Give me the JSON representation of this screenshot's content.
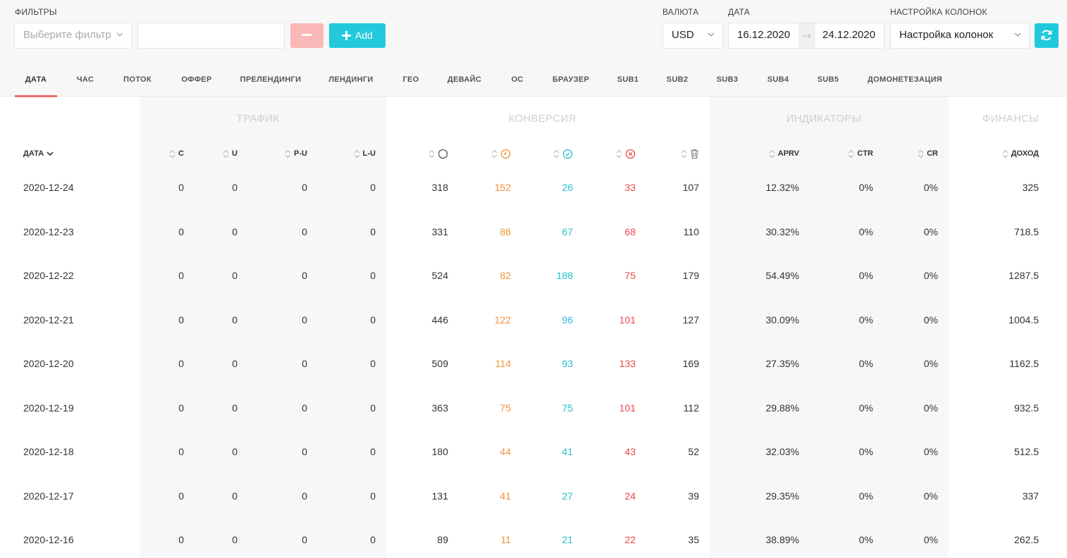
{
  "header": {
    "filters_label": "ФИЛЬТРЫ",
    "filter_placeholder": "Выберите фильтр",
    "add_label": "Add",
    "currency_label": "ВАЛЮТА",
    "currency_value": "USD",
    "date_label": "ДАТА",
    "date_from": "16.12.2020",
    "date_to": "24.12.2020",
    "columns_label": "НАСТРОЙКА КОЛОНОК",
    "columns_value": "Настройка колонок"
  },
  "tabs": [
    "ДАТА",
    "ЧАС",
    "ПОТОК",
    "ОФФЕР",
    "ПРЕЛЕНДИНГИ",
    "ЛЕНДИНГИ",
    "ГЕО",
    "ДЕВАЙС",
    "ОС",
    "БРАУЗЕР",
    "SUB1",
    "SUB2",
    "SUB3",
    "SUB4",
    "SUB5",
    "ДОМОНЕТЕЗАЦИЯ"
  ],
  "active_tab": "ДАТА",
  "groups": {
    "traffic": "ТРАФИК",
    "conversion": "КОНВЕРСИЯ",
    "indicators": "ИНДИКАТОРЫ",
    "finance": "ФИНАНСЫ"
  },
  "columns": {
    "date": "ДАТА",
    "c": "C",
    "u": "U",
    "pu": "P-U",
    "lu": "L-U",
    "aprv": "APRV",
    "ctr": "CTR",
    "cr": "CR",
    "income": "ДОХОД"
  },
  "conversion_icons": [
    "circle-icon",
    "clock-icon",
    "check-circle-icon",
    "x-circle-icon",
    "trash-icon"
  ],
  "colors": {
    "accent": "#22c9dc",
    "pending": "#f2913a",
    "approved": "#22c0d4",
    "rejected": "#ef4747",
    "remove_button": "#fbb8b8"
  },
  "rows": [
    {
      "date": "2020-12-24",
      "c": "0",
      "u": "0",
      "pu": "0",
      "lu": "0",
      "total": "318",
      "pending": "152",
      "approved": "26",
      "rejected": "33",
      "trash": "107",
      "aprv": "12.32%",
      "ctr": "0%",
      "cr": "0%",
      "income": "325"
    },
    {
      "date": "2020-12-23",
      "c": "0",
      "u": "0",
      "pu": "0",
      "lu": "0",
      "total": "331",
      "pending": "86",
      "approved": "67",
      "rejected": "68",
      "trash": "110",
      "aprv": "30.32%",
      "ctr": "0%",
      "cr": "0%",
      "income": "718.5"
    },
    {
      "date": "2020-12-22",
      "c": "0",
      "u": "0",
      "pu": "0",
      "lu": "0",
      "total": "524",
      "pending": "82",
      "approved": "188",
      "rejected": "75",
      "trash": "179",
      "aprv": "54.49%",
      "ctr": "0%",
      "cr": "0%",
      "income": "1287.5"
    },
    {
      "date": "2020-12-21",
      "c": "0",
      "u": "0",
      "pu": "0",
      "lu": "0",
      "total": "446",
      "pending": "122",
      "approved": "96",
      "rejected": "101",
      "trash": "127",
      "aprv": "30.09%",
      "ctr": "0%",
      "cr": "0%",
      "income": "1004.5"
    },
    {
      "date": "2020-12-20",
      "c": "0",
      "u": "0",
      "pu": "0",
      "lu": "0",
      "total": "509",
      "pending": "114",
      "approved": "93",
      "rejected": "133",
      "trash": "169",
      "aprv": "27.35%",
      "ctr": "0%",
      "cr": "0%",
      "income": "1162.5"
    },
    {
      "date": "2020-12-19",
      "c": "0",
      "u": "0",
      "pu": "0",
      "lu": "0",
      "total": "363",
      "pending": "75",
      "approved": "75",
      "rejected": "101",
      "trash": "112",
      "aprv": "29.88%",
      "ctr": "0%",
      "cr": "0%",
      "income": "932.5"
    },
    {
      "date": "2020-12-18",
      "c": "0",
      "u": "0",
      "pu": "0",
      "lu": "0",
      "total": "180",
      "pending": "44",
      "approved": "41",
      "rejected": "43",
      "trash": "52",
      "aprv": "32.03%",
      "ctr": "0%",
      "cr": "0%",
      "income": "512.5"
    },
    {
      "date": "2020-12-17",
      "c": "0",
      "u": "0",
      "pu": "0",
      "lu": "0",
      "total": "131",
      "pending": "41",
      "approved": "27",
      "rejected": "24",
      "trash": "39",
      "aprv": "29.35%",
      "ctr": "0%",
      "cr": "0%",
      "income": "337"
    },
    {
      "date": "2020-12-16",
      "c": "0",
      "u": "0",
      "pu": "0",
      "lu": "0",
      "total": "89",
      "pending": "11",
      "approved": "21",
      "rejected": "22",
      "trash": "35",
      "aprv": "38.89%",
      "ctr": "0%",
      "cr": "0%",
      "income": "262.5"
    }
  ]
}
